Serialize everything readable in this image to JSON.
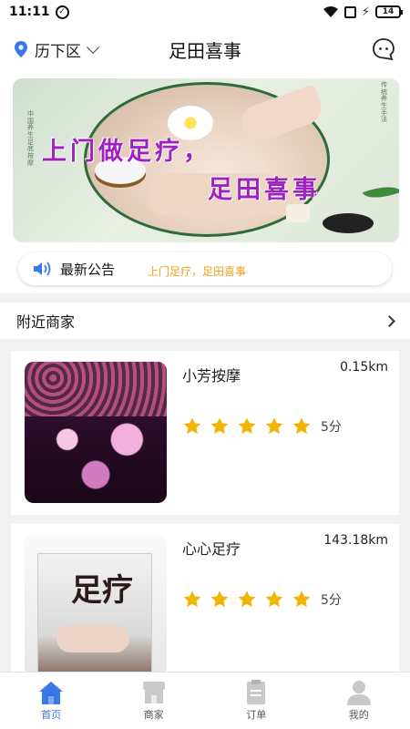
{
  "status": {
    "time": "11:11",
    "battery": "14"
  },
  "header": {
    "location": "历下区",
    "title": "足田喜事"
  },
  "banner": {
    "line1": "上门做足疗，",
    "line2": "足田喜事",
    "side_left": "中国养生足底按摩",
    "side_right": "传统养生手法"
  },
  "notice": {
    "label": "最新公告",
    "text": "上门足疗，足田喜事"
  },
  "nearby": {
    "title": "附近商家"
  },
  "merchants": [
    {
      "name": "小芳按摩",
      "distance": "0.15km",
      "rating": 5,
      "score_label": "5分"
    },
    {
      "name": "心心足疗",
      "distance": "143.18km",
      "rating": 5,
      "score_label": "5分",
      "poster_text": "足疗"
    }
  ],
  "tabs": [
    {
      "label": "首页",
      "icon": "home-icon",
      "active": true
    },
    {
      "label": "商家",
      "icon": "shop-icon",
      "active": false
    },
    {
      "label": "订单",
      "icon": "order-icon",
      "active": false
    },
    {
      "label": "我的",
      "icon": "user-icon",
      "active": false
    }
  ],
  "colors": {
    "accent": "#3a78e8",
    "star": "#f2b400",
    "notice_text": "#f0a020",
    "banner_text": "#a020c0"
  }
}
